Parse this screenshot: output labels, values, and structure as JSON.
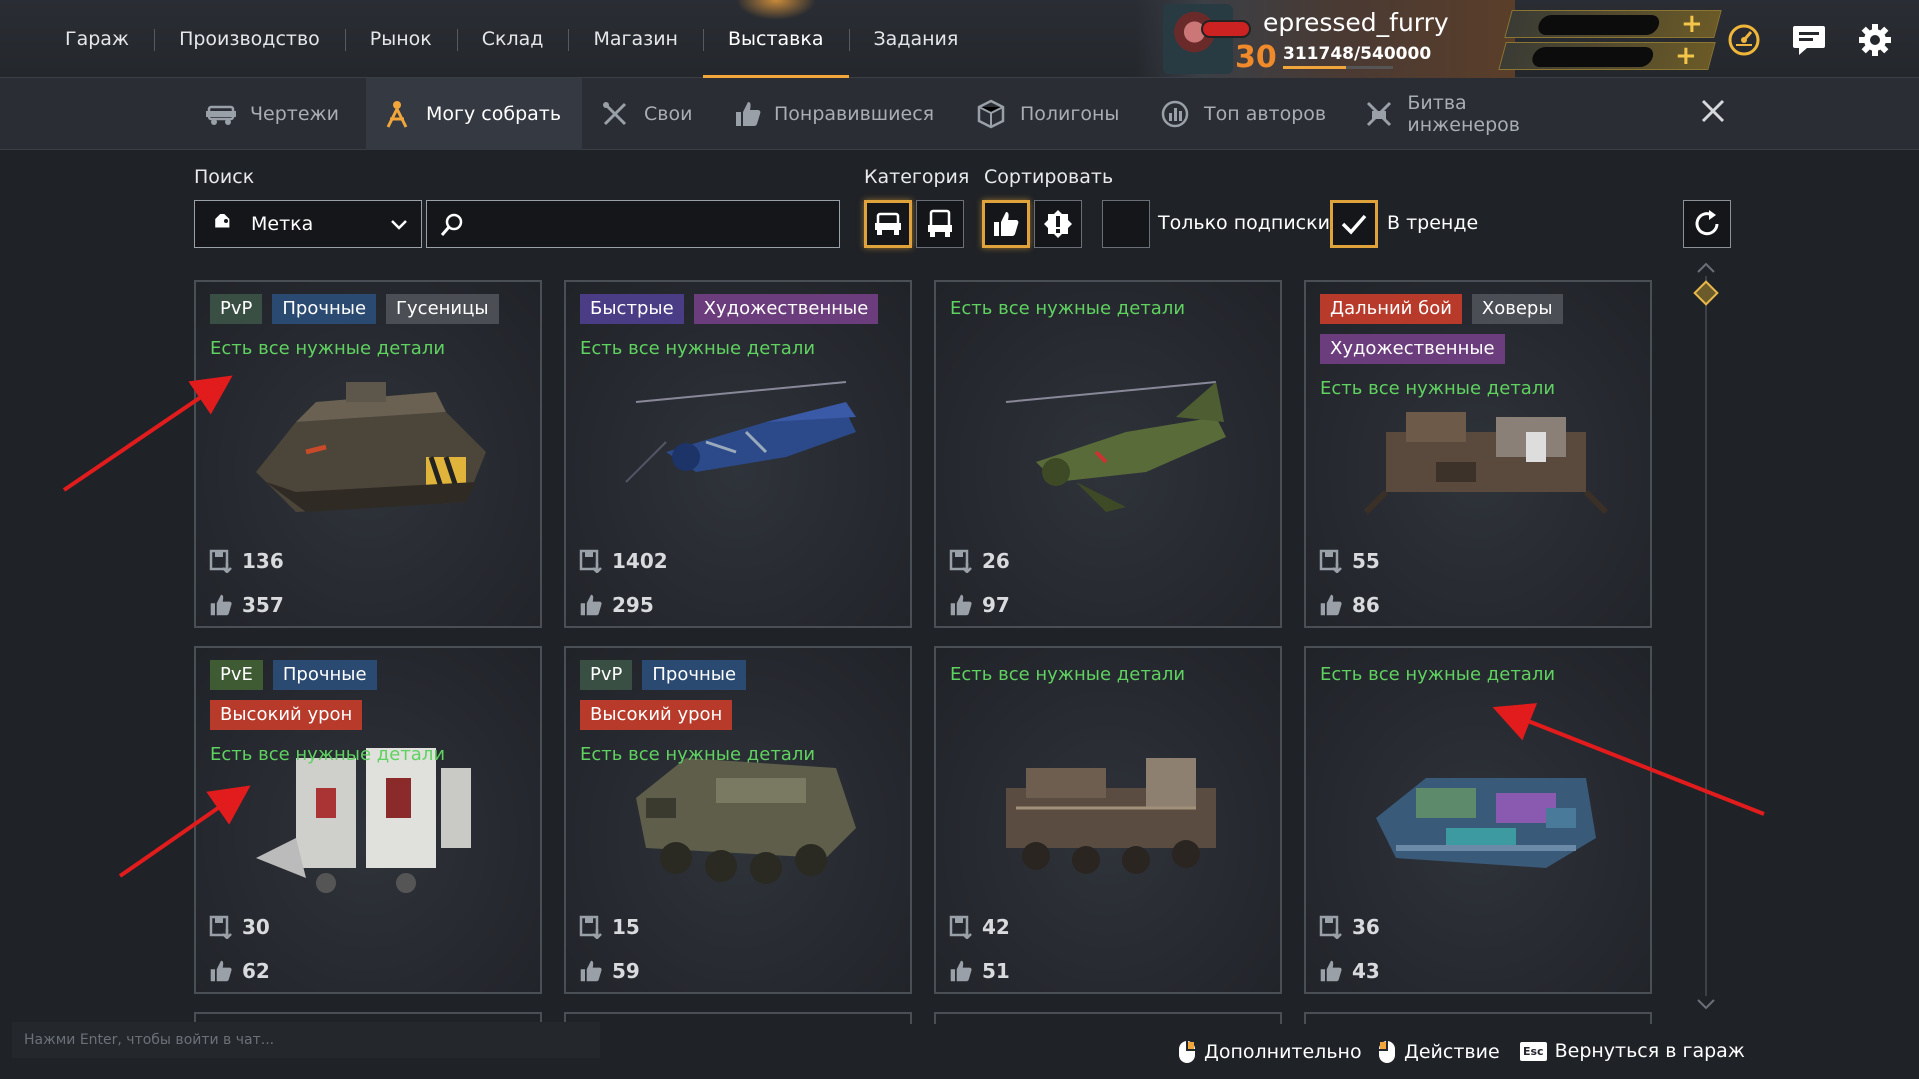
{
  "nav": {
    "items": [
      "Гараж",
      "Производство",
      "Рынок",
      "Склад",
      "Магазин",
      "Выставка",
      "Задания"
    ],
    "active_index": 5
  },
  "profile": {
    "username": "epressed_furry",
    "level": "30",
    "xp": "311748/540000",
    "xp_fraction": 0.577
  },
  "subtabs": {
    "items": [
      {
        "label": "Чертежи",
        "icon": "blueprint-car-icon"
      },
      {
        "label": "Могу собрать",
        "icon": "wrench-person-icon"
      },
      {
        "label": "Свои",
        "icon": "crossed-tools-icon"
      },
      {
        "label": "Понравившиеся",
        "icon": "thumbs-up-icon"
      },
      {
        "label": "Полигоны",
        "icon": "polygon-icon"
      },
      {
        "label": "Топ авторов",
        "icon": "top-authors-icon"
      },
      {
        "label": "Битва инженеров",
        "icon": "engineer-battle-icon"
      }
    ],
    "active_index": 1
  },
  "filters": {
    "search_label": "Поиск",
    "category_label": "Категория",
    "sort_label": "Сортировать",
    "select_value": "Метка",
    "search_value": "",
    "subscriptions_label": "Только подписки",
    "subscriptions_checked": false,
    "trending_label": "В тренде",
    "trending_checked": true
  },
  "cards": [
    {
      "tags": [
        {
          "text": "PvP",
          "kind": "pvp"
        },
        {
          "text": "Прочные",
          "kind": "str"
        },
        {
          "text": "Гусеницы",
          "kind": "gray"
        }
      ],
      "ready": "Есть все нужные детали",
      "downloads": "136",
      "likes": "357",
      "vehicle": "tracked-tank"
    },
    {
      "tags": [
        {
          "text": "Быстрые",
          "kind": "fast"
        },
        {
          "text": "Художественные",
          "kind": "art"
        }
      ],
      "ready": "Есть все нужные детали",
      "downloads": "1402",
      "likes": "295",
      "vehicle": "blue-helicopter"
    },
    {
      "tags": [],
      "ready": "Есть все нужные детали",
      "downloads": "26",
      "likes": "97",
      "vehicle": "green-helicopter"
    },
    {
      "tags": [
        {
          "text": "Дальний бой",
          "kind": "red"
        },
        {
          "text": "Ховеры",
          "kind": "gray"
        },
        {
          "text": "Художественные",
          "kind": "art"
        }
      ],
      "ready": "Есть все нужные детали",
      "downloads": "55",
      "likes": "86",
      "vehicle": "hover-fortress"
    },
    {
      "tags": [
        {
          "text": "PvE",
          "kind": "pve"
        },
        {
          "text": "Прочные",
          "kind": "str"
        },
        {
          "text": "Высокий урон",
          "kind": "red"
        }
      ],
      "ready": "Есть все нужные детали",
      "downloads": "30",
      "likes": "62",
      "vehicle": "white-walker"
    },
    {
      "tags": [
        {
          "text": "PvP",
          "kind": "pvp"
        },
        {
          "text": "Прочные",
          "kind": "str"
        },
        {
          "text": "Высокий урон",
          "kind": "red"
        }
      ],
      "ready": "Есть все нужные детали",
      "downloads": "15",
      "likes": "59",
      "vehicle": "armored-truck"
    },
    {
      "tags": [],
      "ready": "Есть все нужные детали",
      "downloads": "42",
      "likes": "51",
      "vehicle": "rusty-rover"
    },
    {
      "tags": [],
      "ready": "Есть все нужные детали",
      "downloads": "36",
      "likes": "43",
      "vehicle": "neon-crawler"
    }
  ],
  "chat": {
    "placeholder": "Нажми Enter, чтобы войти в чат..."
  },
  "hints": [
    {
      "label": "Дополнительно",
      "key": "mouse-right-icon"
    },
    {
      "label": "Действие",
      "key": "mouse-left-icon"
    },
    {
      "label": "Вернуться в гараж",
      "key": "Esc"
    }
  ],
  "colors": {
    "accent": "#e0a23a",
    "ready": "#5fd260",
    "red_tag": "#b73a2a"
  }
}
